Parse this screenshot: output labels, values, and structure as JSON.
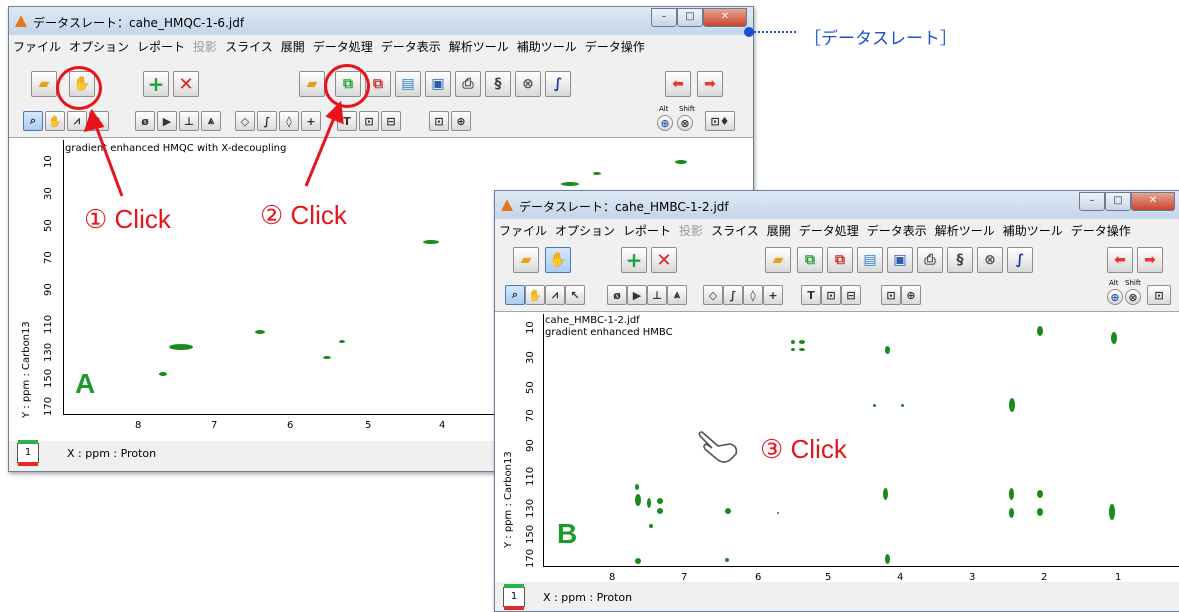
{
  "annotation": {
    "label": "［データスレート］",
    "color": "#1a4fd6"
  },
  "window_a": {
    "title": "データスレート：cahe_HMQC-1-6.jdf",
    "menu": [
      "ファイル",
      "オプション",
      "レポート",
      "投影",
      "スライス",
      "展開",
      "データ処理",
      "データ表示",
      "解析ツール",
      "補助ツール",
      "データ操作"
    ],
    "disabled_menu": "投影",
    "plot_text": "gradient enhanced HMQC with X-decoupling",
    "y_ticks": [
      "10",
      "30",
      "50",
      "70",
      "90",
      "110",
      "130",
      "150",
      "170"
    ],
    "x_ticks": [
      "8",
      "7",
      "6",
      "5",
      "4"
    ],
    "ylabel": "Y : ppm : Carbon13",
    "xlabel": "X : ppm : Proton",
    "letter": "A",
    "page": "1"
  },
  "window_b": {
    "title": "データスレート：cahe_HMBC-1-2.jdf",
    "menu": [
      "ファイル",
      "オプション",
      "レポート",
      "投影",
      "スライス",
      "展開",
      "データ処理",
      "データ表示",
      "解析ツール",
      "補助ツール",
      "データ操作"
    ],
    "disabled_menu": "投影",
    "plot_text1": "cahe_HMBC-1-2.jdf",
    "plot_text2": "gradient enhanced HMBC",
    "y_ticks": [
      "10",
      "30",
      "50",
      "70",
      "90",
      "110",
      "130",
      "150",
      "170"
    ],
    "x_ticks": [
      "8",
      "7",
      "6",
      "5",
      "4",
      "3",
      "2",
      "1"
    ],
    "ylabel": "Y : ppm : Carbon13",
    "xlabel": "X : ppm : Proton",
    "letter": "B",
    "page": "1"
  },
  "callouts": {
    "step1": "① Click",
    "step2": "② Click",
    "step3": "③ Click"
  },
  "toolbar": {
    "alt": "Alt",
    "shift": "Shift"
  },
  "colors": {
    "accent_red": "#e8141c",
    "peak_green": "#1a8a1a",
    "letter_green": "#1c9b2a"
  }
}
